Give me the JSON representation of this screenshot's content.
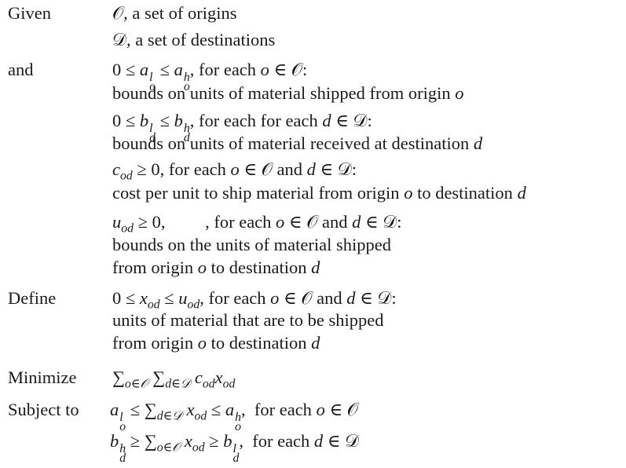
{
  "labels": {
    "given": "Given",
    "and": "and",
    "define": "Define",
    "minimize": "Minimize",
    "subject_to": "Subject to"
  },
  "given": [
    "𝒪, a set of origins",
    "𝒟, a set of destinations"
  ],
  "and": [
    "0 ≤ *a*^{l}_{o} ≤ *a*^{h}_{o}, for each *o* ∈ 𝒪:",
    "bounds on units of material shipped from origin *o*",
    "0 ≤ *b*^{l}_{d} ≤ *b*^{h}_{d}, for each for each *d* ∈ 𝒟:",
    "bounds on units of material received at destination *d*",
    "*c*_{od} ≥ 0, for each *o* ∈ 𝒪 and *d* ∈ 𝒟:",
    "cost per unit to ship material from origin *o* to destination *d*",
    "*u*_{od} ≥ 0,         , for each *o* ∈ 𝒪 and *d* ∈ 𝒟:",
    "bounds on the units of material shipped",
    "from origin *o* to destination *d*"
  ],
  "define": [
    " 0 ≤ *x*_{od} ≤ *u*_{od}, for each *o* ∈ 𝒪 and *d* ∈ 𝒟:",
    "units of material that are to be shipped",
    "from origin *o* to destination *d*"
  ],
  "minimize": "∑_{o∈𝒪} ∑_{d∈𝒟} *c*_{od}*x*_{od}",
  "subject_to": [
    "*a*^{l}_{o} ≤ ∑_{d∈𝒟} *x*_{od} ≤ *a*^{h}_{o},  for each *o* ∈ 𝒪",
    "*b*^{h}_{d} ≥ ∑_{o∈𝒪} *x*_{od} ≥ *b*^{l}_{d},  for each *d* ∈ 𝒟"
  ]
}
